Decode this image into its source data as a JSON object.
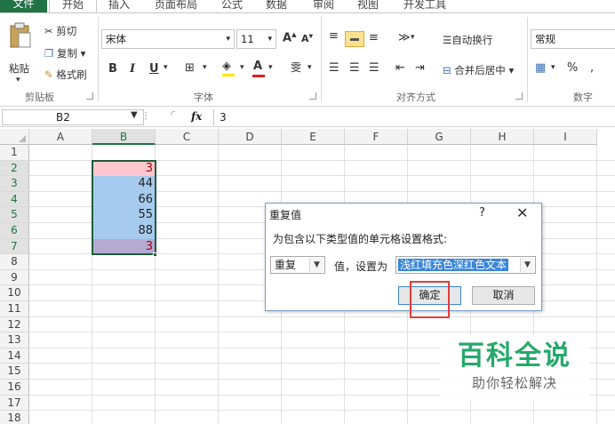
{
  "ribbon_tabs": [
    "文件",
    "开始",
    "插入",
    "页面布局",
    "公式",
    "数据",
    "审阅",
    "视图",
    "开发工具"
  ],
  "clipboard": {
    "paste": "粘贴",
    "cut": "剪切",
    "copy": "复制",
    "format_painter": "格式刷",
    "group": "剪贴板"
  },
  "font": {
    "name": "宋体",
    "size": "11",
    "bold": "B",
    "italic": "I",
    "underline": "U",
    "group": "字体"
  },
  "alignment": {
    "wrap": "自动换行",
    "merge": "合并后居中",
    "group": "对齐方式"
  },
  "number": {
    "format": "常规",
    "group": "数字",
    "percent": "%"
  },
  "formula_bar": {
    "name_box": "B2",
    "fx": "fx",
    "content": "3"
  },
  "columns": [
    "A",
    "B",
    "C",
    "D",
    "E",
    "F",
    "G",
    "H",
    "I"
  ],
  "rows": [
    "1",
    "2",
    "3",
    "4",
    "5",
    "6",
    "7",
    "8",
    "9",
    "10",
    "11",
    "12",
    "13",
    "14",
    "15",
    "16",
    "17",
    "18"
  ],
  "cells_b": [
    {
      "row": "2",
      "value": "3",
      "style": "dup"
    },
    {
      "row": "3",
      "value": "44",
      "style": "blu"
    },
    {
      "row": "4",
      "value": "66",
      "style": "blu"
    },
    {
      "row": "5",
      "value": "55",
      "style": "blu"
    },
    {
      "row": "6",
      "value": "88",
      "style": "blu"
    },
    {
      "row": "7",
      "value": "3",
      "style": "purp"
    }
  ],
  "dialog": {
    "title": "重复值",
    "help": "?",
    "close": "✕",
    "description": "为包含以下类型值的单元格设置格式:",
    "type_value": "重复",
    "value_label": "值，设置为",
    "format_value": "浅红填充色深红色文本",
    "ok": "确定",
    "cancel": "取消"
  },
  "watermark": {
    "main": "百科全说",
    "sub": "助你轻松解决"
  },
  "colors": {
    "accent": "#217346",
    "dup_fill": "#ffc7ce",
    "dup_text": "#9c0006",
    "highlight": "#e23b3b"
  }
}
